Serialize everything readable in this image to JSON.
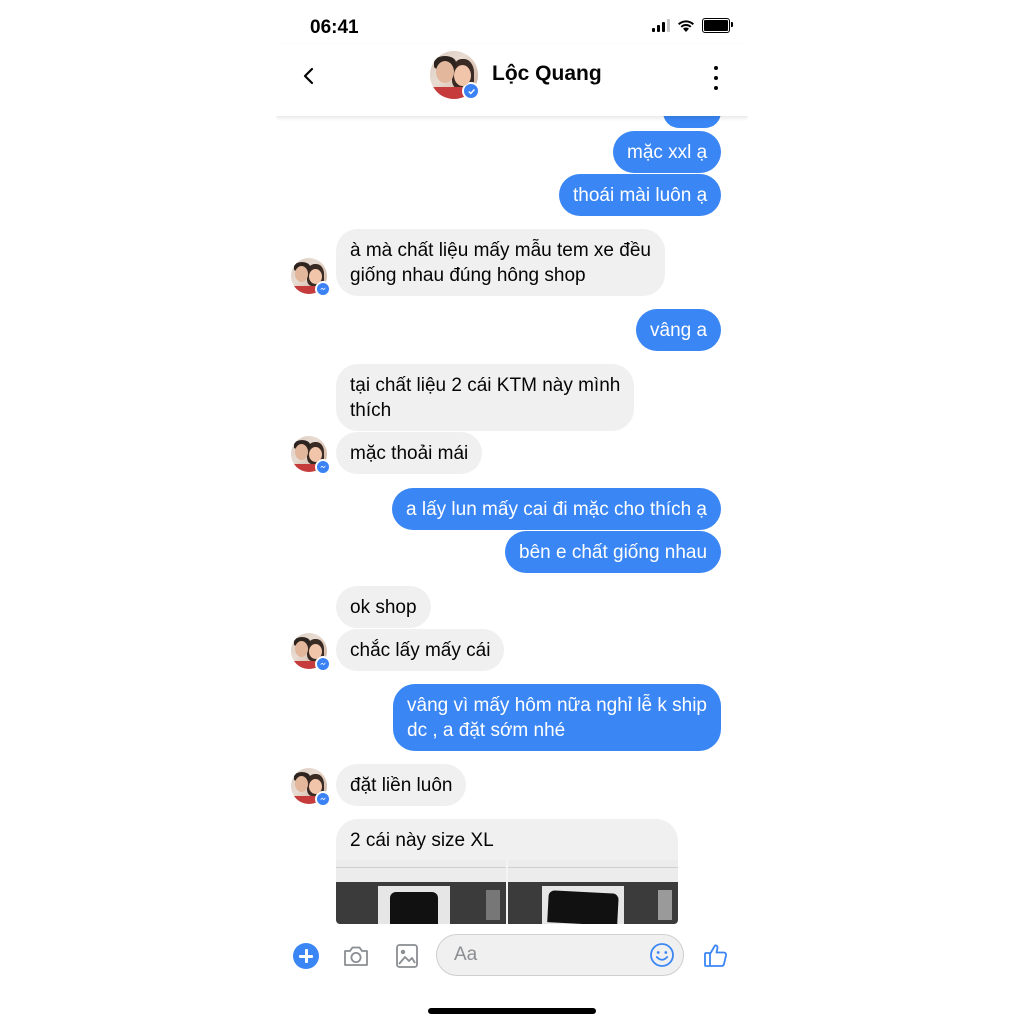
{
  "status_bar": {
    "time": "06:41"
  },
  "header": {
    "contact_name": "Lộc Quang",
    "icons": [
      "back-icon",
      "avatar",
      "verified-badge-icon",
      "more-vertical-icon"
    ]
  },
  "messages": [
    {
      "id": "m1",
      "direction": "out",
      "text": "mặc xxl ạ"
    },
    {
      "id": "m2",
      "direction": "out",
      "text": "thoái mài luôn ạ"
    },
    {
      "id": "m3",
      "direction": "in",
      "lines": [
        "à mà chất liệu mấy mẫu tem xe đều",
        "giống nhau đúng hông shop"
      ]
    },
    {
      "id": "m4",
      "direction": "out",
      "text": "vâng a"
    },
    {
      "id": "m5",
      "direction": "in",
      "lines": [
        "tại chất liệu 2 cái KTM này mình",
        "thích"
      ]
    },
    {
      "id": "m6",
      "direction": "in",
      "text": "mặc thoải mái"
    },
    {
      "id": "m7",
      "direction": "out",
      "text": "a lấy lun mấy cai đi mặc cho thích ạ"
    },
    {
      "id": "m8",
      "direction": "out",
      "text": "bên e chất giống nhau"
    },
    {
      "id": "m9",
      "direction": "in",
      "text": "ok shop"
    },
    {
      "id": "m10",
      "direction": "in",
      "text": "chắc lấy mấy cái"
    },
    {
      "id": "m11",
      "direction": "out",
      "lines": [
        "vâng vì mấy hôm nữa nghỉ lễ k ship",
        "dc , a đặt sớm nhé"
      ]
    },
    {
      "id": "m12",
      "direction": "in",
      "text": "đặt liền luôn"
    },
    {
      "id": "m13",
      "direction": "in",
      "text": "2 cái này size XL"
    }
  ],
  "composer": {
    "placeholder": "Aa",
    "icons": [
      "plus-icon",
      "camera-icon",
      "image-icon",
      "emoji-icon",
      "thumbs-up-icon"
    ]
  },
  "colors": {
    "outgoing_bubble": "#3a86f5",
    "incoming_bubble": "#f0f0f0",
    "accent": "#3a86f5"
  }
}
